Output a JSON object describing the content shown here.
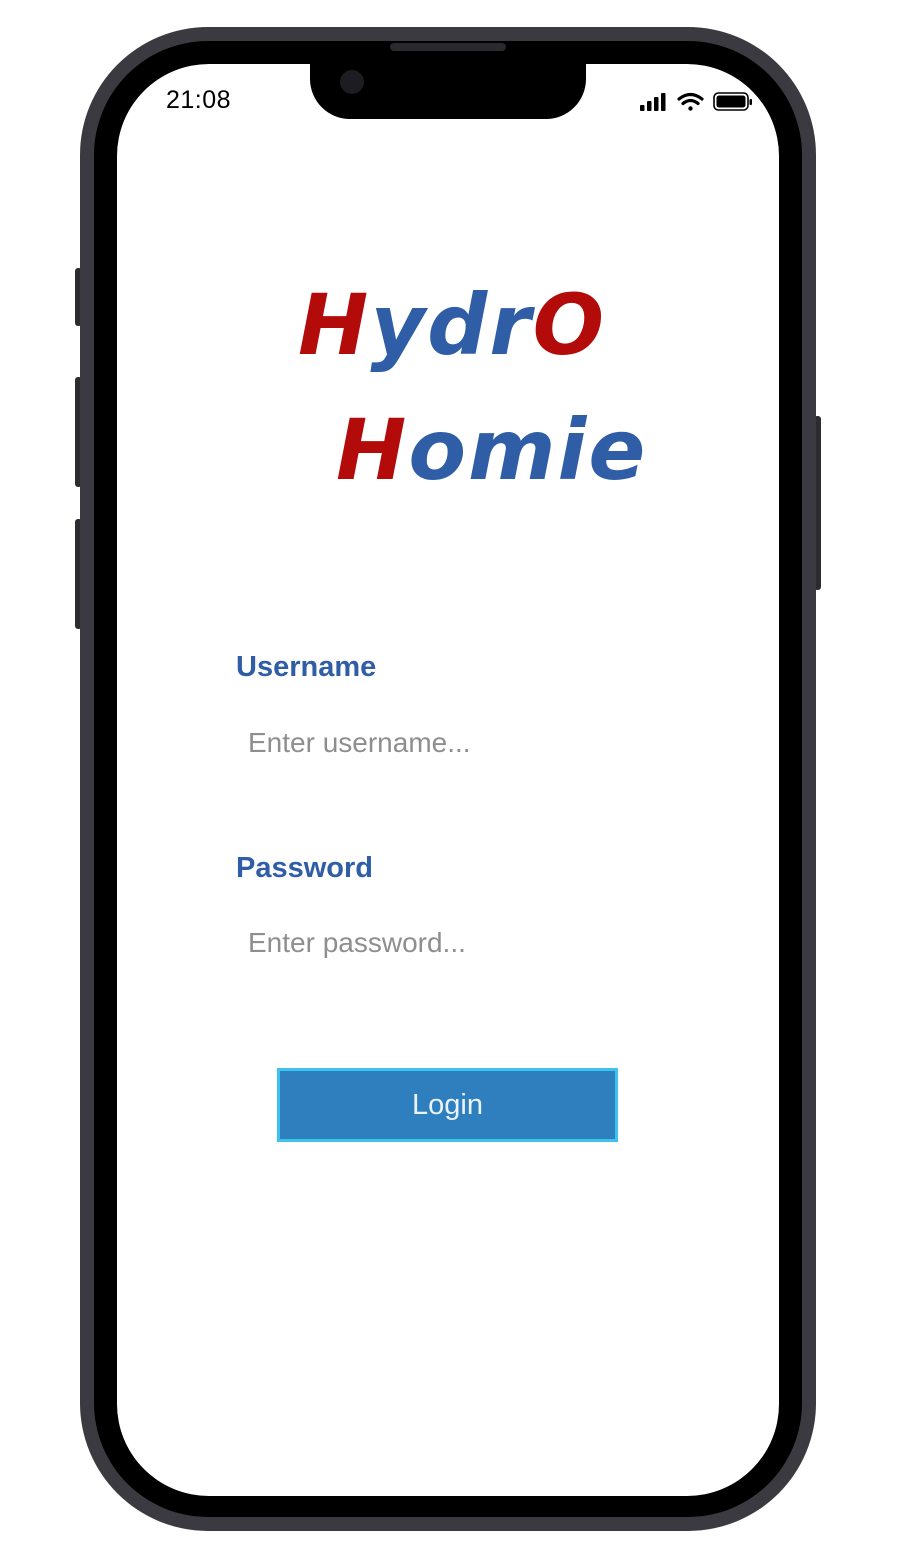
{
  "status_bar": {
    "time": "21:08",
    "icons": [
      "signal-icon",
      "wifi-icon",
      "battery-icon"
    ]
  },
  "logo": {
    "line1": [
      {
        "text": "H",
        "color": "#b30a0a"
      },
      {
        "text": "ydr",
        "color": "#2f5ea6"
      },
      {
        "text": "O",
        "color": "#b30a0a"
      }
    ],
    "line2": [
      {
        "text": "H",
        "color": "#b30a0a"
      },
      {
        "text": "omie",
        "color": "#2f5ea6"
      }
    ]
  },
  "form": {
    "username_label": "Username",
    "username_placeholder": "Enter username...",
    "username_value": "",
    "password_label": "Password",
    "password_placeholder": "Enter password...",
    "password_value": "",
    "login_label": "Login"
  },
  "colors": {
    "brand_red": "#b30a0a",
    "brand_blue": "#2f5ea6",
    "button_fill": "#2f7ebe",
    "button_border": "#3fc3ee"
  }
}
